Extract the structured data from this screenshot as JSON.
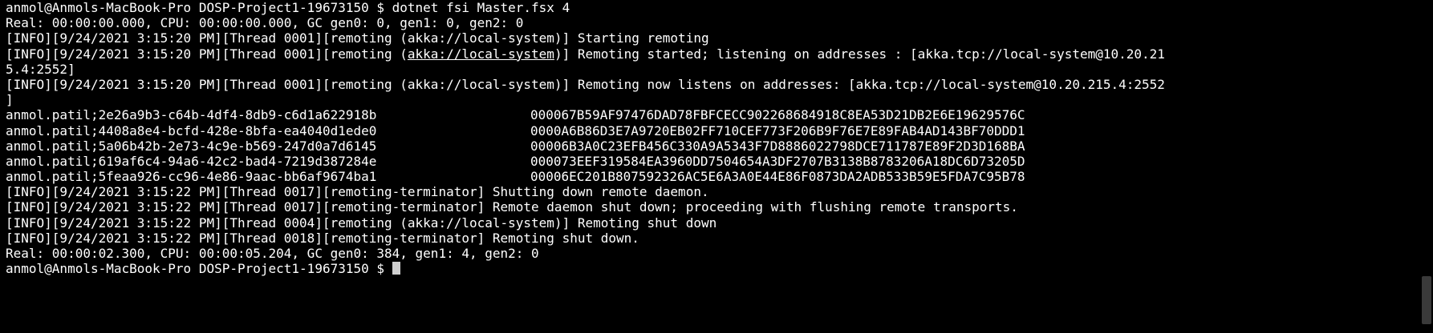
{
  "terminal": {
    "lines": [
      "anmol@Anmols-MacBook-Pro DOSP-Project1-19673150 $ dotnet fsi Master.fsx 4",
      "Real: 00:00:00.000, CPU: 00:00:00.000, GC gen0: 0, gen1: 0, gen2: 0",
      "[INFO][9/24/2021 3:15:20 PM][Thread 0001][remoting (akka://local-system)] Starting remoting"
    ],
    "remoting_started": {
      "prefix": "[INFO][9/24/2021 3:15:20 PM][Thread 0001][remoting (",
      "link": "akka://local-system",
      "suffix": ")] Remoting started; listening on addresses : [akka.tcp://local-system@10.20.21",
      "wrap": "5.4:2552]"
    },
    "remoting_listens": {
      "text": "[INFO][9/24/2021 3:15:20 PM][Thread 0001][remoting (akka://local-system)] Remoting now listens on addresses: [akka.tcp://local-system@10.20.215.4:2552",
      "wrap": "]"
    },
    "hash_rows": [
      {
        "input": "anmol.patil;2e26a9b3-c64b-4df4-8db9-c6d1a622918b",
        "hash": "000067B59AF97476DAD78FBFCECC902268684918C8EA53D21DB2E6E19629576C"
      },
      {
        "input": "anmol.patil;4408a8e4-bcfd-428e-8bfa-ea4040d1ede0",
        "hash": "0000A6B86D3E7A9720EB02FF710CEF773F206B9F76E7E89FAB4AD143BF70DDD1"
      },
      {
        "input": "anmol.patil;5a06b42b-2e73-4c9e-b569-247d0a7d6145",
        "hash": "00006B3A0C23EFB456C330A9A5343F7D8886022798DCE711787E89F2D3D168BA"
      },
      {
        "input": "anmol.patil;619af6c4-94a6-42c2-bad4-7219d387284e",
        "hash": "000073EEF319584EA3960DD7504654A3DF2707B3138B8783206A18DC6D73205D"
      },
      {
        "input": "anmol.patil;5feaa926-cc96-4e86-9aac-bb6af9674ba1",
        "hash": "00006EC201B807592326AC5E6A3A0E44E86F0873DA2ADB533B59E5FDA7C95B78"
      }
    ],
    "shutdown_lines": [
      "[INFO][9/24/2021 3:15:22 PM][Thread 0017][remoting-terminator] Shutting down remote daemon.",
      "[INFO][9/24/2021 3:15:22 PM][Thread 0017][remoting-terminator] Remote daemon shut down; proceeding with flushing remote transports.",
      "[INFO][9/24/2021 3:15:22 PM][Thread 0004][remoting (akka://local-system)] Remoting shut down",
      "[INFO][9/24/2021 3:15:22 PM][Thread 0018][remoting-terminator] Remoting shut down.",
      "Real: 00:00:02.300, CPU: 00:00:05.204, GC gen0: 384, gen1: 4, gen2: 0"
    ],
    "prompt": "anmol@Anmols-MacBook-Pro DOSP-Project1-19673150 $ "
  },
  "colors": {
    "background": "#000000",
    "foreground": "#ffffff",
    "cursor": "#d0d0d0"
  }
}
